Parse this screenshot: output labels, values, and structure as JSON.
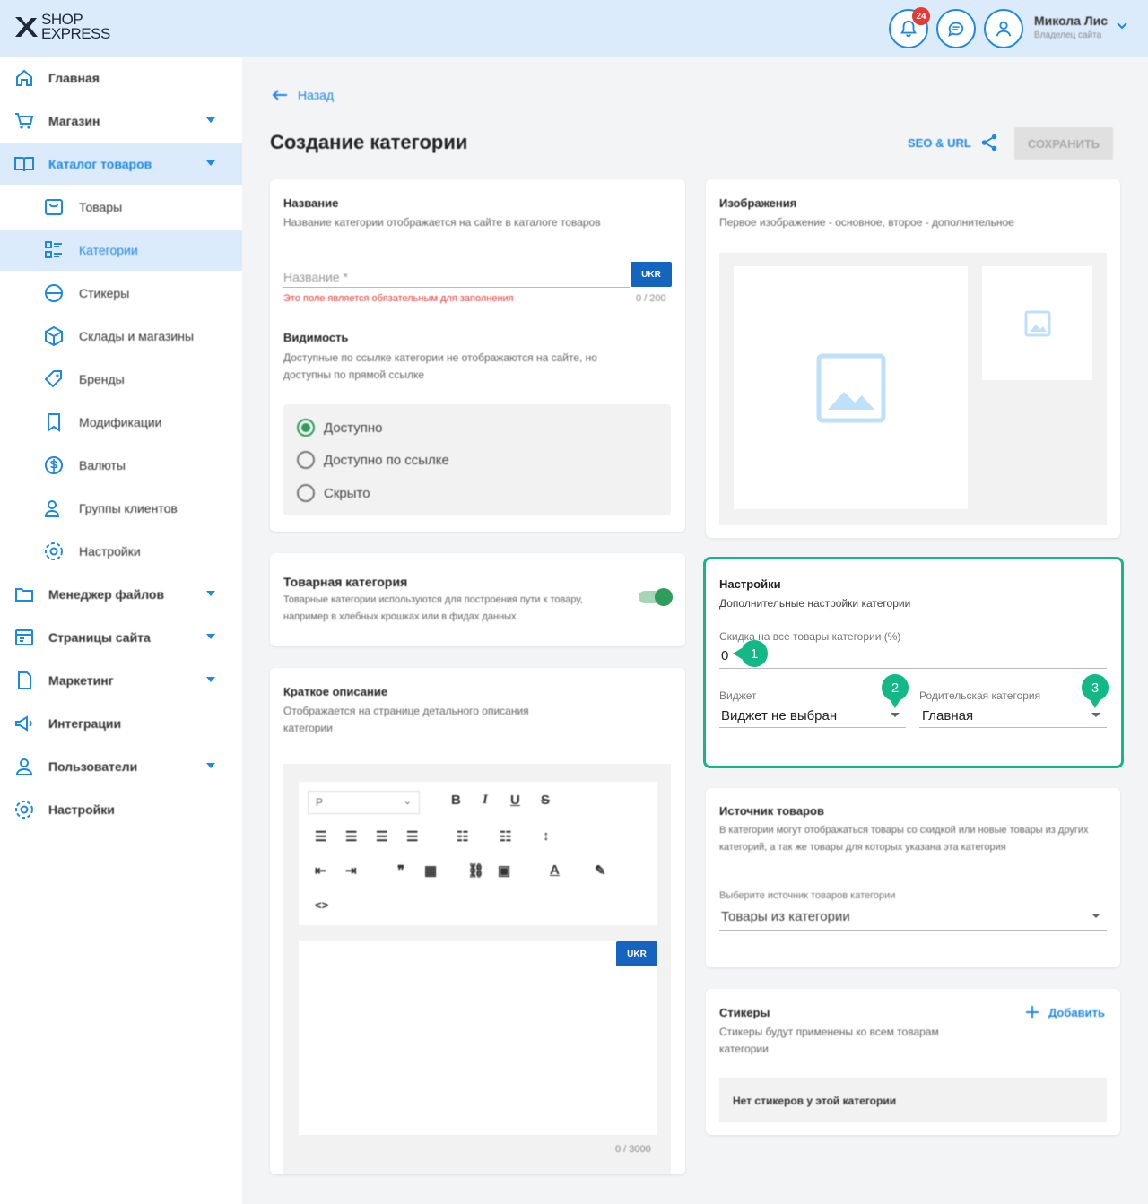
{
  "header": {
    "logo_line1": "SHOP",
    "logo_line2": "EXPRESS",
    "notifications_count": "24",
    "user_name": "Микола Лис",
    "user_role": "Владелец сайта"
  },
  "sidebar": {
    "items": [
      {
        "label": "Главная",
        "icon": "home-icon"
      },
      {
        "label": "Магазин",
        "icon": "cart-icon"
      },
      {
        "label": "Каталог товаров",
        "icon": "catalog-icon"
      },
      {
        "label": "Товары",
        "icon": "box-icon"
      },
      {
        "label": "Категории",
        "icon": "list-icon"
      },
      {
        "label": "Стикеры",
        "icon": "sticker-icon"
      },
      {
        "label": "Склады и магазины",
        "icon": "warehouse-icon"
      },
      {
        "label": "Бренды",
        "icon": "tag-icon"
      },
      {
        "label": "Модификации",
        "icon": "bookmark-icon"
      },
      {
        "label": "Валюты",
        "icon": "currency-icon"
      },
      {
        "label": "Группы клиентов",
        "icon": "users-icon"
      },
      {
        "label": "Настройки",
        "icon": "gear-icon"
      },
      {
        "label": "Менеджер файлов",
        "icon": "folder-icon"
      },
      {
        "label": "Страницы сайта",
        "icon": "pages-icon"
      },
      {
        "label": "Маркетинг",
        "icon": "marketing-icon"
      },
      {
        "label": "Интеграции",
        "icon": "megaphone-icon"
      },
      {
        "label": "Пользователи",
        "icon": "user-icon"
      },
      {
        "label": "Настройки",
        "icon": "gear-icon"
      }
    ]
  },
  "main": {
    "back_label": "Назад",
    "page_title": "Создание категории",
    "seo_label": "SEO & URL",
    "save_label": "СОХРАНИТЬ"
  },
  "name_card": {
    "title": "Название",
    "subtitle": "Название категории отображается на сайте в каталоге товаров",
    "placeholder": "Название *",
    "lang": "UKR",
    "error": "Это поле является обязательным для заполнения",
    "counter": "0 / 200",
    "visibility_title": "Видимость",
    "visibility_sub": "Доступные по ссылке категории не отображаются на сайте, но доступны по прямой ссылке",
    "options": [
      "Доступно",
      "Доступно по ссылке",
      "Скрыто"
    ],
    "selected": "Доступно"
  },
  "product_category": {
    "title": "Товарная категория",
    "subtitle": "Товарные категории используются для построения пути к товару, например в хлебных крошках или в фидах данных",
    "enabled": true
  },
  "short_desc": {
    "title": "Краткое описание",
    "subtitle": "Отображается на странице детального описания категории",
    "format": "P",
    "lang": "UKR",
    "counter": "0 / 3000"
  },
  "images": {
    "title": "Изображения",
    "subtitle": "Первое изображение - основное, второе - дополнительное"
  },
  "settings": {
    "title": "Настройки",
    "subtitle": "Дополнительные настройки категории",
    "discount_label": "Скидка на все товары категории (%)",
    "discount_value": "0",
    "widget_label": "Виджет",
    "widget_value": "Виджет не выбран",
    "parent_label": "Родительская категория",
    "parent_value": "Главная",
    "markers": [
      "1",
      "2",
      "3"
    ],
    "accent": "#12b886"
  },
  "source": {
    "title": "Источник товаров",
    "subtitle": "В категории могут отображаться товары со скидкой или новые товары из других категорий, а так же товары для которых указана эта категория",
    "select_label": "Выберите источник товаров категории",
    "select_value": "Товары из категории"
  },
  "stickers": {
    "title": "Стикеры",
    "subtitle": "Стикеры будут применены ко всем товарам категории",
    "add_label": "Добавить",
    "empty": "Нет стикеров у этой категории"
  }
}
